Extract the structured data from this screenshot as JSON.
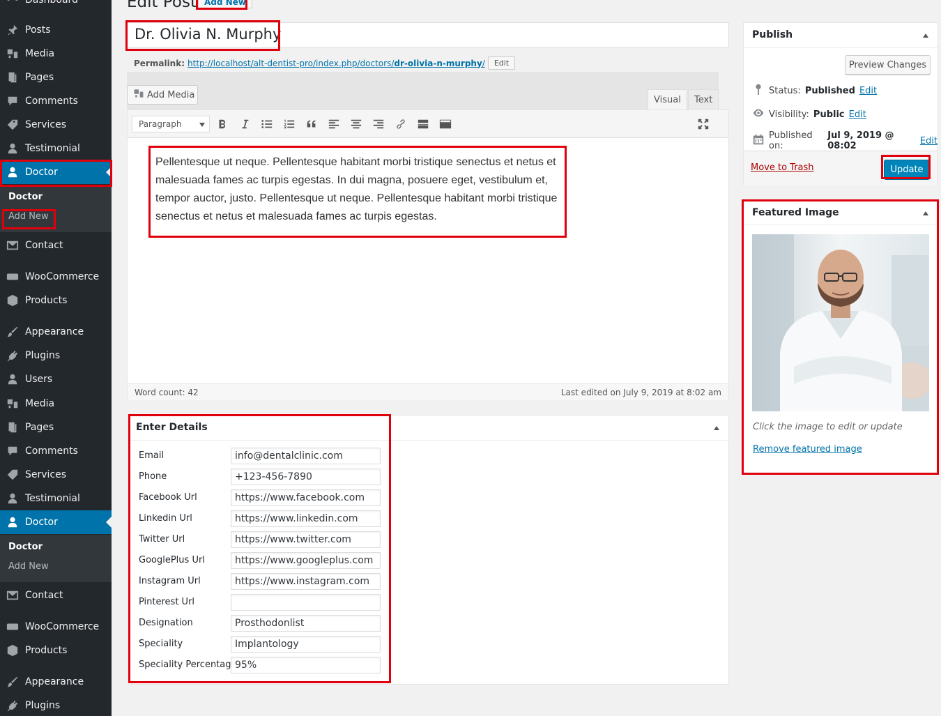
{
  "sidebar": {
    "items": [
      {
        "label": "Dashboard",
        "icon": "dashboard-icon"
      },
      {
        "label": "Posts",
        "icon": "pin-icon"
      },
      {
        "label": "Media",
        "icon": "media-icon"
      },
      {
        "label": "Pages",
        "icon": "pages-icon"
      },
      {
        "label": "Comments",
        "icon": "comment-icon"
      },
      {
        "label": "Services",
        "icon": "tag-icon"
      },
      {
        "label": "Testimonial",
        "icon": "user-icon"
      },
      {
        "label": "Doctor",
        "icon": "users-icon"
      },
      {
        "label": "Contact",
        "icon": "mail-icon"
      },
      {
        "label": "WooCommerce",
        "icon": "woo-icon"
      },
      {
        "label": "Products",
        "icon": "box-icon"
      },
      {
        "label": "Appearance",
        "icon": "brush-icon"
      },
      {
        "label": "Plugins",
        "icon": "plug-icon"
      },
      {
        "label": "Users",
        "icon": "user-icon"
      },
      {
        "label": "Media",
        "icon": "media-icon"
      },
      {
        "label": "Pages",
        "icon": "pages-icon"
      },
      {
        "label": "Comments",
        "icon": "comment-icon"
      },
      {
        "label": "Services",
        "icon": "tag-icon"
      },
      {
        "label": "Testimonial",
        "icon": "user-icon"
      },
      {
        "label": "Doctor",
        "icon": "users-icon"
      },
      {
        "label": "Contact",
        "icon": "mail-icon"
      },
      {
        "label": "WooCommerce",
        "icon": "woo-icon"
      },
      {
        "label": "Products",
        "icon": "box-icon"
      },
      {
        "label": "Appearance",
        "icon": "brush-icon"
      },
      {
        "label": "Plugins",
        "icon": "plug-icon"
      }
    ],
    "submenu": {
      "head": "Doctor",
      "add_new": "Add New"
    }
  },
  "page": {
    "heading": "Edit Post",
    "add_new": "Add New",
    "title": "Dr. Olivia N. Murphy",
    "permalink_label": "Permalink:",
    "permalink_base": "http://localhost/alt-dentist-pro/index.php/doctors/",
    "permalink_slug": "dr-olivia-n-murphy",
    "permalink_end": "/",
    "permalink_edit": "Edit"
  },
  "editor": {
    "add_media": "Add Media",
    "tab_visual": "Visual",
    "tab_text": "Text",
    "format": "Paragraph",
    "content": "Pellentesque ut neque. Pellentesque habitant morbi tristique senectus et netus et malesuada fames ac turpis egestas. In dui magna, posuere eget, vestibulum et, tempor auctor, justo. Pellentesque ut neque. Pellentesque habitant morbi tristique senectus et netus et malesuada fames ac turpis egestas.",
    "word_count": "Word count: 42",
    "last_edited": "Last edited on July 9, 2019 at 8:02 am"
  },
  "details": {
    "title": "Enter Details",
    "fields": [
      {
        "label": "Email",
        "value": "info@dentalclinic.com"
      },
      {
        "label": "Phone",
        "value": "+123-456-7890"
      },
      {
        "label": "Facebook Url",
        "value": "https://www.facebook.com"
      },
      {
        "label": "Linkedin Url",
        "value": "https://www.linkedin.com"
      },
      {
        "label": "Twitter Url",
        "value": "https://www.twitter.com"
      },
      {
        "label": "GooglePlus Url",
        "value": "https://www.googleplus.com"
      },
      {
        "label": "Instagram Url",
        "value": "https://www.instagram.com"
      },
      {
        "label": "Pinterest Url",
        "value": ""
      },
      {
        "label": "Designation",
        "value": "Prosthodonlist"
      },
      {
        "label": "Speciality",
        "value": "Implantology"
      },
      {
        "label": "Speciality Percentage",
        "value": "95%"
      }
    ]
  },
  "publish": {
    "title": "Publish",
    "preview": "Preview Changes",
    "status_label": "Status:",
    "status_value": "Published",
    "visibility_label": "Visibility:",
    "visibility_value": "Public",
    "published_label": "Published on:",
    "published_value": "Jul 9, 2019 @ 08:02",
    "edit": "Edit",
    "trash": "Move to Trash",
    "update": "Update"
  },
  "featured": {
    "title": "Featured Image",
    "hint": "Click the image to edit or update",
    "remove": "Remove featured image"
  },
  "colors": {
    "sidebar_bg": "#23282d",
    "active_bg": "#0073aa",
    "highlight": "#e0000c",
    "primary_button": "#0085ba"
  }
}
